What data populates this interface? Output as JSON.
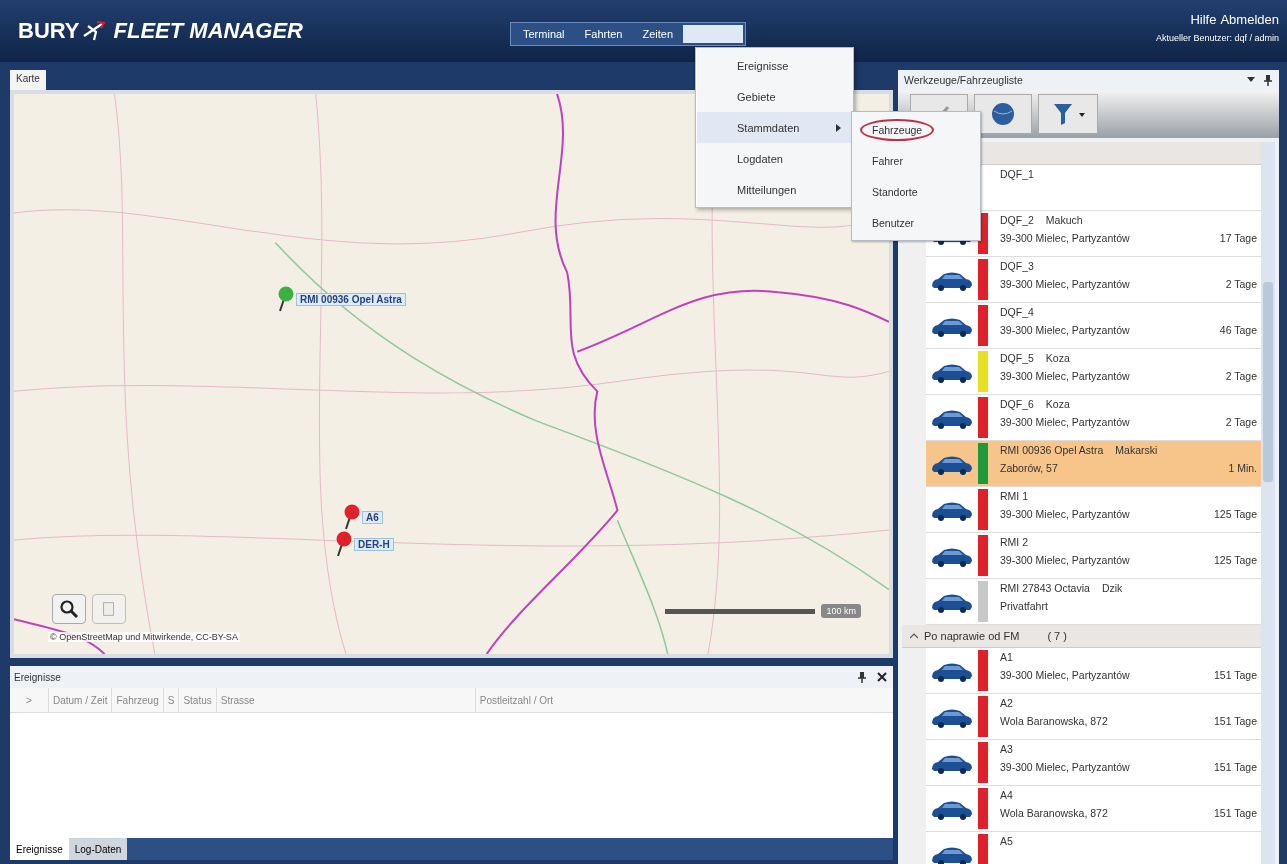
{
  "header": {
    "logo_brand": "BURY",
    "logo_product": "FLEET MANAGER",
    "nav": [
      {
        "label": "Terminal",
        "selected": false
      },
      {
        "label": "Fahrten",
        "selected": false
      },
      {
        "label": "Zeiten",
        "selected": false
      },
      {
        "selected": true
      }
    ],
    "links": [
      "Hilfe",
      "Abmelden"
    ],
    "current_user": "Aktueller Benutzer: dqf / admin"
  },
  "menu": {
    "items": [
      {
        "label": "Ereignisse",
        "selected": false,
        "submenu": false
      },
      {
        "label": "Gebiete",
        "selected": false,
        "submenu": false
      },
      {
        "label": "Stammdaten",
        "selected": true,
        "submenu": true
      },
      {
        "label": "Logdaten",
        "selected": false,
        "submenu": false
      },
      {
        "label": "Mitteilungen",
        "selected": false,
        "submenu": false
      }
    ],
    "submenu": [
      {
        "label": "Fahrzeuge",
        "circled": true
      },
      {
        "label": "Fahrer",
        "circled": false
      },
      {
        "label": "Standorte",
        "circled": false
      },
      {
        "label": "Benutzer",
        "circled": false
      }
    ]
  },
  "map_panel": {
    "tab": "Karte",
    "markers": [
      {
        "label": "RMI 00936 Opel Astra",
        "color": "#3cb043"
      },
      {
        "label": "A6",
        "color": "#e0202a"
      },
      {
        "label": "DER-H",
        "color": "#e0202a"
      }
    ],
    "scale": "100 km",
    "attribution": "© OpenStreetMap und Mitwirkende, CC-BY-SA"
  },
  "events_panel": {
    "title": "Ereignisse",
    "columns": [
      ">",
      "Datum / Zeit",
      "Fahrzeug",
      "S",
      "Status",
      "Strasse",
      "Postleitzahl / Ort"
    ]
  },
  "bottom_tabs": [
    {
      "label": "Ereignisse",
      "selected": true
    },
    {
      "label": "Log-Daten",
      "selected": false
    }
  ],
  "vehicle_panel": {
    "title": "Werkzeuge/Fahrzeugliste",
    "groups": [
      {
        "vehicles": [
          {
            "name": "DQF_1",
            "selected": false
          },
          {
            "name": "DQF_2",
            "driver": "Makuch",
            "address": "39-300 Mielec, Partyzantów",
            "age": "17 Tage",
            "color": "#e0202a",
            "selected": false
          },
          {
            "name": "DQF_3",
            "address": "39-300 Mielec, Partyzantów",
            "age": "2 Tage",
            "color": "#e0202a",
            "selected": false
          },
          {
            "name": "DQF_4",
            "address": "39-300 Mielec, Partyzantów",
            "age": "46 Tage",
            "color": "#e0202a",
            "selected": false
          },
          {
            "name": "DQF_5",
            "driver": "Koza",
            "address": "39-300 Mielec, Partyzantów",
            "age": "2 Tage",
            "color": "#e8e020",
            "selected": false
          },
          {
            "name": "DQF_6",
            "driver": "Koza",
            "address": "39-300 Mielec, Partyzantów",
            "age": "2 Tage",
            "color": "#e0202a",
            "selected": false
          },
          {
            "name": "RMI 00936 Opel Astra",
            "driver": "Makarski",
            "address": "Zaborów, 57",
            "age": "1 Min.",
            "color": "#1f9a3a",
            "selected": true
          },
          {
            "name": "RMI 1",
            "address": "39-300 Mielec, Partyzantów",
            "age": "125 Tage",
            "color": "#e0202a",
            "selected": false
          },
          {
            "name": "RMI 2",
            "address": "39-300 Mielec, Partyzantów",
            "age": "125 Tage",
            "color": "#e0202a",
            "selected": false
          },
          {
            "name": "RMI 27843 Octavia",
            "driver": "Dzik",
            "address": "Privatfahrt",
            "color": "#c8c8c8",
            "selected": false
          }
        ]
      },
      {
        "title": "Po naprawie od FM",
        "count": "( 7 )",
        "expanded": true,
        "vehicles": [
          {
            "name": "A1",
            "address": "39-300 Mielec, Partyzantów",
            "age": "151 Tage",
            "color": "#e0202a",
            "selected": false
          },
          {
            "name": "A2",
            "address": "Wola Baranowska, 872",
            "age": "151 Tage",
            "color": "#e0202a",
            "selected": false
          },
          {
            "name": "A3",
            "address": "39-300 Mielec, Partyzantów",
            "age": "151 Tage",
            "color": "#e0202a",
            "selected": false
          },
          {
            "name": "A4",
            "address": "Wola Baranowska, 872",
            "age": "151 Tage",
            "color": "#e0202a",
            "selected": false
          },
          {
            "name": "A5",
            "color": "#e0202a",
            "selected": false
          }
        ]
      }
    ]
  }
}
